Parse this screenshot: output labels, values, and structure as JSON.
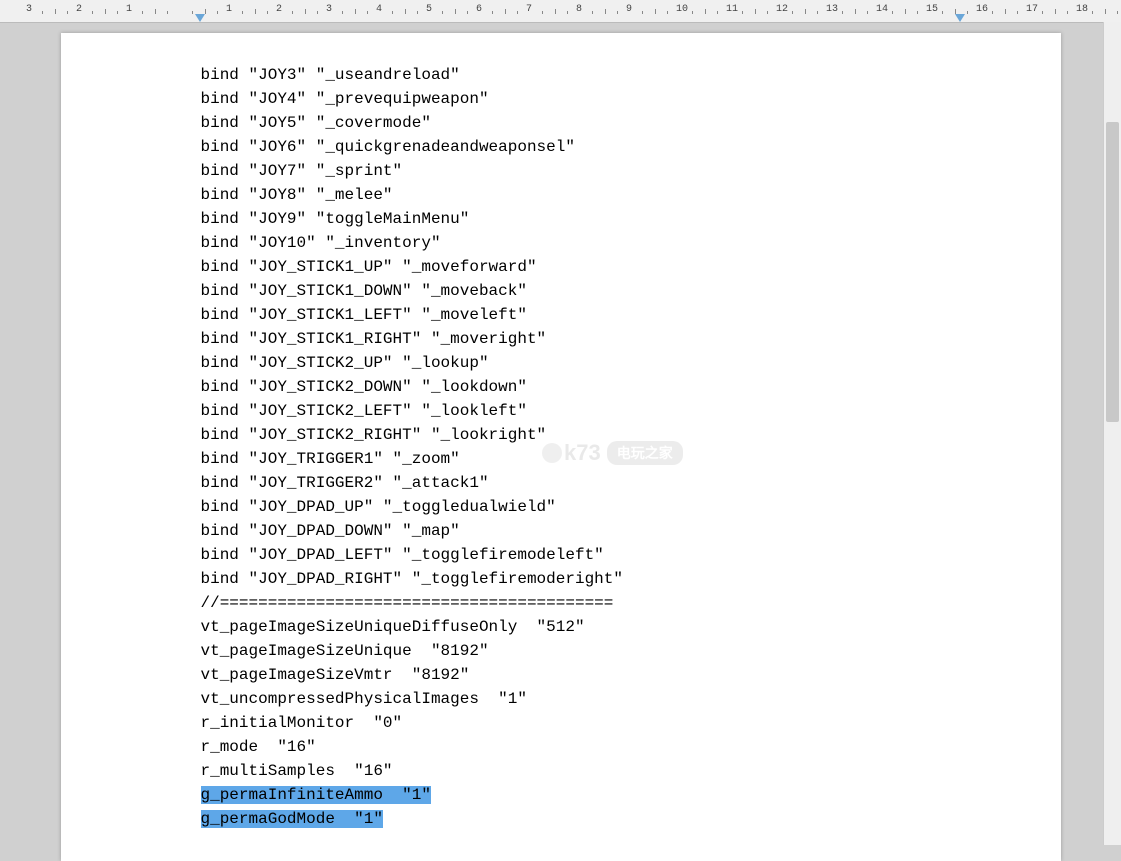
{
  "ruler": {
    "marks": [
      "3",
      "2",
      "1",
      "",
      "1",
      "2",
      "3",
      "4",
      "5",
      "6",
      "7",
      "8",
      "9",
      "10",
      "11",
      "12",
      "13",
      "14",
      "15",
      "16",
      "17",
      "18"
    ]
  },
  "lines": [
    {
      "t": "bind \"JOY3\" \"_useandreload\"",
      "sel": false
    },
    {
      "t": "bind \"JOY4\" \"_prevequipweapon\"",
      "sel": false
    },
    {
      "t": "bind \"JOY5\" \"_covermode\"",
      "sel": false
    },
    {
      "t": "bind \"JOY6\" \"_quickgrenadeandweaponsel\"",
      "sel": false
    },
    {
      "t": "bind \"JOY7\" \"_sprint\"",
      "sel": false
    },
    {
      "t": "bind \"JOY8\" \"_melee\"",
      "sel": false
    },
    {
      "t": "bind \"JOY9\" \"toggleMainMenu\"",
      "sel": false
    },
    {
      "t": "bind \"JOY10\" \"_inventory\"",
      "sel": false
    },
    {
      "t": "bind \"JOY_STICK1_UP\" \"_moveforward\"",
      "sel": false
    },
    {
      "t": "bind \"JOY_STICK1_DOWN\" \"_moveback\"",
      "sel": false
    },
    {
      "t": "bind \"JOY_STICK1_LEFT\" \"_moveleft\"",
      "sel": false
    },
    {
      "t": "bind \"JOY_STICK1_RIGHT\" \"_moveright\"",
      "sel": false
    },
    {
      "t": "bind \"JOY_STICK2_UP\" \"_lookup\"",
      "sel": false
    },
    {
      "t": "bind \"JOY_STICK2_DOWN\" \"_lookdown\"",
      "sel": false
    },
    {
      "t": "bind \"JOY_STICK2_LEFT\" \"_lookleft\"",
      "sel": false
    },
    {
      "t": "bind \"JOY_STICK2_RIGHT\" \"_lookright\"",
      "sel": false
    },
    {
      "t": "bind \"JOY_TRIGGER1\" \"_zoom\"",
      "sel": false
    },
    {
      "t": "bind \"JOY_TRIGGER2\" \"_attack1\"",
      "sel": false
    },
    {
      "t": "bind \"JOY_DPAD_UP\" \"_toggledualwield\"",
      "sel": false
    },
    {
      "t": "bind \"JOY_DPAD_DOWN\" \"_map\"",
      "sel": false
    },
    {
      "t": "bind \"JOY_DPAD_LEFT\" \"_togglefiremodeleft\"",
      "sel": false
    },
    {
      "t": "bind \"JOY_DPAD_RIGHT\" \"_togglefiremoderight\"",
      "sel": false
    },
    {
      "t": "//=========================================",
      "sel": false
    },
    {
      "t": "vt_pageImageSizeUniqueDiffuseOnly  \"512\"",
      "sel": false
    },
    {
      "t": "vt_pageImageSizeUnique  \"8192\"",
      "sel": false
    },
    {
      "t": "vt_pageImageSizeVmtr  \"8192\"",
      "sel": false
    },
    {
      "t": "vt_uncompressedPhysicalImages  \"1\"",
      "sel": false
    },
    {
      "t": "r_initialMonitor  \"0\"",
      "sel": false
    },
    {
      "t": "r_mode  \"16\"",
      "sel": false
    },
    {
      "t": "r_multiSamples  \"16\"",
      "sel": false
    },
    {
      "t": "g_permaInfiniteAmmo  \"1\"",
      "sel": true
    },
    {
      "t": "g_permaGodMode  \"1\"",
      "sel": true
    }
  ],
  "watermark": {
    "brand": "k73",
    "tag": "电玩之家"
  }
}
